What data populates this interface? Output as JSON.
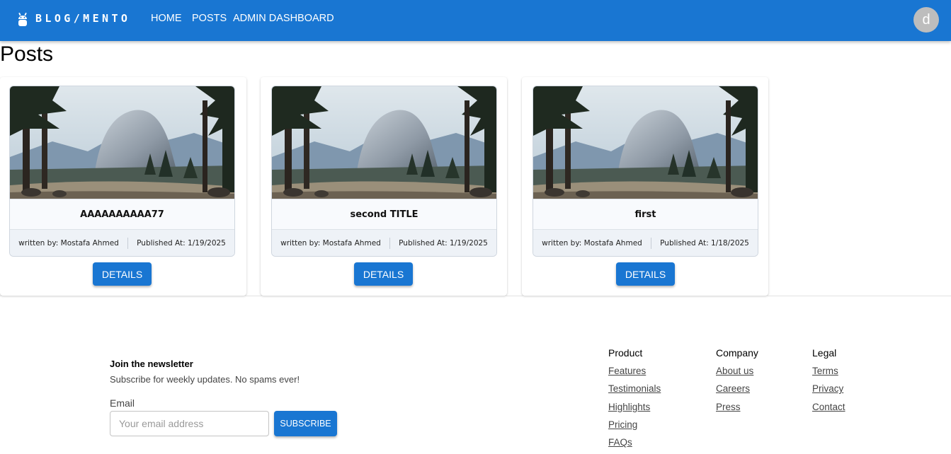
{
  "header": {
    "brand": "BLOG/MENTO",
    "nav": [
      "HOME",
      "POSTS",
      "ADMIN DASHBOARD"
    ],
    "avatar_initial": "d",
    "color": "#1976d2"
  },
  "page": {
    "title": "Posts"
  },
  "posts": [
    {
      "title": "AAAAAAAAAA77",
      "author": "written by: Mostafa Ahmed",
      "published": "Published At: 1/19/2025",
      "button": "DETAILS"
    },
    {
      "title": "second TITLE",
      "author": "written by: Mostafa Ahmed",
      "published": "Published At: 1/19/2025",
      "button": "DETAILS"
    },
    {
      "title": "first",
      "author": "written by: Mostafa Ahmed",
      "published": "Published At: 1/18/2025",
      "button": "DETAILS"
    }
  ],
  "footer": {
    "newsletter": {
      "title": "Join the newsletter",
      "subtitle": "Subscribe for weekly updates. No spams ever!",
      "email_label": "Email",
      "email_placeholder": "Your email address",
      "button": "SUBSCRIBE"
    },
    "columns": [
      {
        "heading": "Product",
        "links": [
          "Features",
          "Testimonials",
          "Highlights",
          "Pricing",
          "FAQs"
        ]
      },
      {
        "heading": "Company",
        "links": [
          "About us",
          "Careers",
          "Press"
        ]
      },
      {
        "heading": "Legal",
        "links": [
          "Terms",
          "Privacy",
          "Contact"
        ]
      }
    ]
  }
}
